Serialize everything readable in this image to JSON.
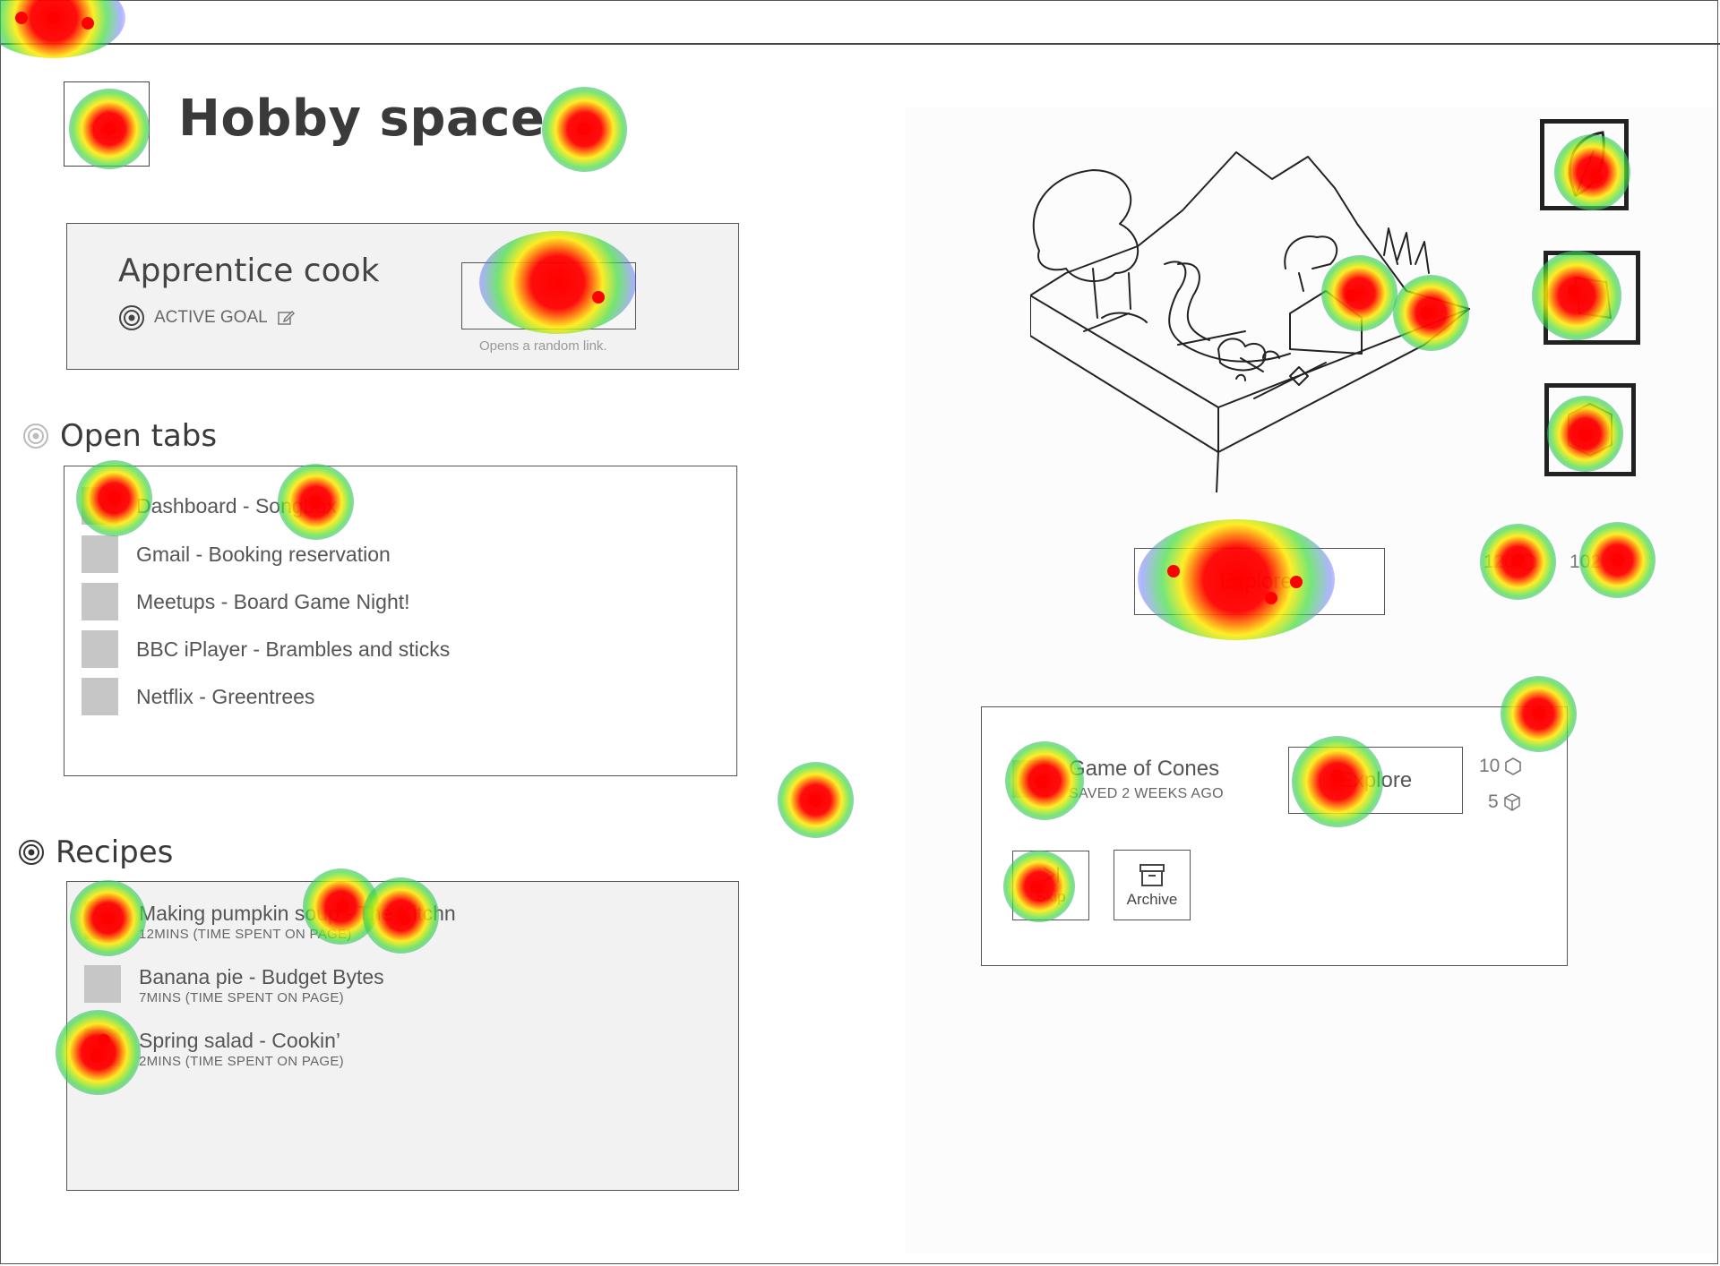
{
  "page": {
    "title": "Hobby space"
  },
  "goal": {
    "title": "Apprentice cook",
    "status_label": "ACTIVE GOAL",
    "button_hint": "Opens a random link."
  },
  "open_tabs": {
    "heading": "Open tabs",
    "items": [
      {
        "label": "Dashboard - Songbox"
      },
      {
        "label": "Gmail - Booking reservation"
      },
      {
        "label": "Meetups - Board Game Night!"
      },
      {
        "label": "BBC iPlayer - Brambles and sticks"
      },
      {
        "label": "Netflix - Greentrees"
      }
    ]
  },
  "recipes": {
    "heading": "Recipes",
    "items": [
      {
        "title": "Making pumpkin soup - The Kitchn",
        "meta": "12MINS (TIME SPENT ON PAGE)"
      },
      {
        "title": "Banana pie - Budget Bytes",
        "meta": "7MINS (TIME SPENT ON PAGE)"
      },
      {
        "title": "Spring salad - Cookin’",
        "meta": "2MINS (TIME SPENT ON PAGE)"
      }
    ]
  },
  "explore": {
    "button_label": "Explorer",
    "stat_hex": "120",
    "stat_other": "102"
  },
  "saved_item": {
    "title": "Game of Cones",
    "meta": "SAVED 2 WEEKS AGO",
    "button_label": "Explore",
    "stat_hex": "10",
    "stat_cube": "5",
    "skip_label": "Skip",
    "archive_label": "Archive"
  },
  "icons": {
    "goal": "target-icon",
    "edit": "edit-icon",
    "hex": "hexagon-icon",
    "cube": "cube-icon",
    "skip": "skip-icon",
    "archive": "archive-icon",
    "leaf": "leaf-icon"
  },
  "colors": {
    "card_bg": "#f2f2f2",
    "thumb": "#c6c6c6",
    "border": "#555555"
  }
}
